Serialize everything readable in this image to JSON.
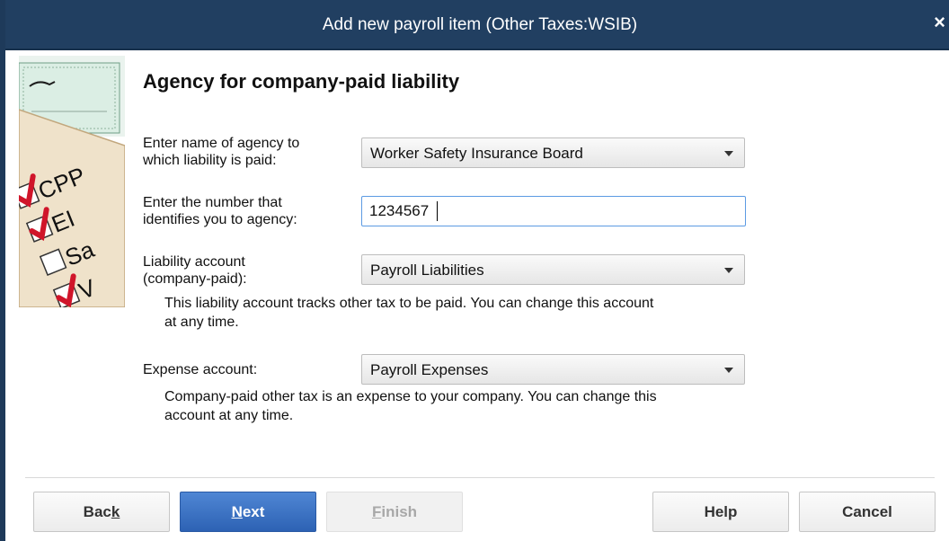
{
  "window": {
    "title": "Add new payroll item (Other Taxes:WSIB)",
    "close_glyph": "×"
  },
  "art": {
    "items": [
      "CPP",
      "EI",
      "Sa",
      "V"
    ]
  },
  "heading": "Agency for company-paid liability",
  "agency": {
    "label_line1": "Enter name of agency to",
    "label_line2": "which liability is paid:",
    "value": "Worker Safety Insurance Board"
  },
  "number": {
    "label_line1": "Enter the number that",
    "label_line2": "identifies you to agency:",
    "value": "1234567"
  },
  "liability": {
    "label_line1": "Liability account",
    "label_line2": "(company-paid):",
    "value": "Payroll Liabilities",
    "note_line1": "This liability account tracks other tax to be paid. You can change this account",
    "note_line2": "at any time."
  },
  "expense": {
    "label": "Expense account:",
    "value": "Payroll Expenses",
    "note_line1": "Company-paid other tax is an expense to your company. You can change this",
    "note_line2": "account at any time."
  },
  "buttons": {
    "back_pre": "Bac",
    "back_key": "k",
    "next_key": "N",
    "next_post": "ext",
    "finish_key": "F",
    "finish_post": "inish",
    "help": "Help",
    "cancel": "Cancel"
  },
  "colors": {
    "titlebar": "#213f61",
    "primary_button": "#3a6fc2",
    "field_focus_border": "#5c9be3",
    "check_mark": "#d0152a"
  }
}
